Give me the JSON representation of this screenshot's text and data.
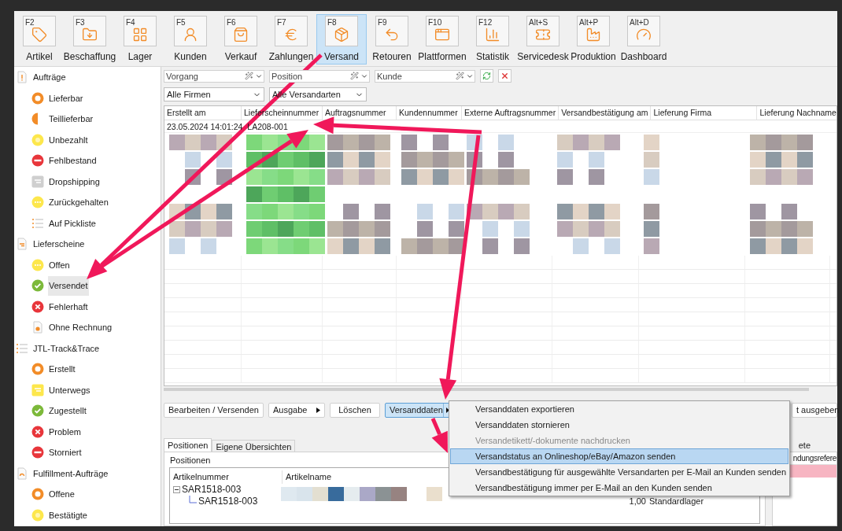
{
  "toolbar": {
    "modules": [
      {
        "key": "F2",
        "label": "Artikel",
        "kind": "tag",
        "selected": false
      },
      {
        "key": "F3",
        "label": "Beschaffung",
        "kind": "folder",
        "selected": false
      },
      {
        "key": "F4",
        "label": "Lager",
        "kind": "grid",
        "selected": false
      },
      {
        "key": "F5",
        "label": "Kunden",
        "kind": "user",
        "selected": false
      },
      {
        "key": "F6",
        "label": "Verkauf",
        "kind": "bag",
        "selected": false
      },
      {
        "key": "F7",
        "label": "Zahlungen",
        "kind": "euro",
        "selected": false
      },
      {
        "key": "F8",
        "label": "Versand",
        "kind": "package",
        "selected": true
      },
      {
        "key": "F9",
        "label": "Retouren",
        "kind": "return",
        "selected": false
      },
      {
        "key": "F10",
        "label": "Plattformen",
        "kind": "window",
        "selected": false
      },
      {
        "key": "F12",
        "label": "Statistik",
        "kind": "chart",
        "selected": false
      },
      {
        "key": "Alt+S",
        "label": "Servicedesk",
        "kind": "ticket",
        "selected": false
      },
      {
        "key": "Alt+P",
        "label": "Produktion",
        "kind": "factory",
        "selected": false
      },
      {
        "key": "Alt+D",
        "label": "Dashboard",
        "kind": "gauge",
        "selected": false
      }
    ]
  },
  "sidebar": {
    "groups": [
      {
        "label": "Aufträge",
        "kind": "order",
        "items": [
          {
            "label": "Lieferbar",
            "kind": "ring-orange",
            "selected": false
          },
          {
            "label": "Teillieferbar",
            "kind": "half",
            "selected": false
          },
          {
            "label": "Unbezahlt",
            "kind": "coin",
            "selected": false
          },
          {
            "label": "Fehlbestand",
            "kind": "minus",
            "selected": false
          },
          {
            "label": "Dropshipping",
            "kind": "note-grey",
            "selected": false
          },
          {
            "label": "Zurückgehalten",
            "kind": "dots",
            "selected": false
          },
          {
            "label": "Auf Pickliste",
            "kind": "list",
            "selected": false
          }
        ]
      },
      {
        "label": "Lieferscheine",
        "kind": "delivery",
        "items": [
          {
            "label": "Offen",
            "kind": "dots",
            "selected": false
          },
          {
            "label": "Versendet",
            "kind": "check",
            "selected": true
          },
          {
            "label": "Fehlerhaft",
            "kind": "cross",
            "selected": false
          },
          {
            "label": "Ohne Rechnung",
            "kind": "doc",
            "selected": false
          }
        ]
      },
      {
        "label": "JTL-Track&Trace",
        "kind": "list",
        "items": [
          {
            "label": "Erstellt",
            "kind": "ring-orange",
            "selected": false
          },
          {
            "label": "Unterwegs",
            "kind": "note-yellow",
            "selected": false
          },
          {
            "label": "Zugestellt",
            "kind": "check",
            "selected": false
          },
          {
            "label": "Problem",
            "kind": "cross",
            "selected": false
          },
          {
            "label": "Storniert",
            "kind": "minus",
            "selected": false
          }
        ]
      },
      {
        "label": "Fulfillment-Aufträge",
        "kind": "fulfillment",
        "items": [
          {
            "label": "Offene",
            "kind": "ring-orange",
            "selected": false
          },
          {
            "label": "Bestätigte",
            "kind": "coin",
            "selected": false
          }
        ]
      }
    ]
  },
  "filters": {
    "fields": [
      {
        "placeholder": "Vorgang"
      },
      {
        "placeholder": "Position"
      },
      {
        "placeholder": "Kunde"
      }
    ],
    "dropdowns": [
      {
        "value": "Alle Firmen"
      },
      {
        "value": "Alle Versandarten"
      }
    ]
  },
  "table": {
    "columns": [
      "Erstellt am",
      "Lieferscheinnummer",
      "Auftragsnummer",
      "Kundennummer",
      "Externe Auftragsnummer",
      "Versandbestätigung am",
      "Lieferung Firma",
      "Lieferung Nachname"
    ],
    "rows": [
      {
        "cells": [
          "23.05.2024 14:01:24",
          "LA208-001"
        ]
      }
    ]
  },
  "buttons": [
    {
      "label": "Bearbeiten / Versenden",
      "kind": "plain"
    },
    {
      "label": "Ausgabe",
      "kind": "submenu"
    },
    {
      "label": "Löschen",
      "kind": "plain"
    },
    {
      "label": "Versanddaten",
      "kind": "split",
      "selected": true
    },
    {
      "label": "t ausgeben",
      "kind": "plain"
    }
  ],
  "menu": {
    "items": [
      {
        "label": "Versanddaten exportieren",
        "disabled": false,
        "selected": false
      },
      {
        "label": "Versanddaten stornieren",
        "disabled": false,
        "selected": false
      },
      {
        "label": "Versandetikett/-dokumente nachdrucken",
        "disabled": true,
        "selected": false
      },
      {
        "label": "Versandstatus an Onlineshop/eBay/Amazon senden",
        "disabled": false,
        "selected": true
      },
      {
        "label": "Versandbestätigung für ausgewählte Versandarten per E-Mail an Kunden senden",
        "disabled": false,
        "selected": false
      },
      {
        "label": "Versandbestätigung immer per E-Mail an den Kunden senden",
        "disabled": false,
        "selected": false
      }
    ]
  },
  "detail_tabs": [
    {
      "label": "Positionen",
      "selected": true
    },
    {
      "label": "Eigene Übersichten",
      "selected": false
    }
  ],
  "positions": {
    "title": "Positionen",
    "columns": [
      "Artikelnummer",
      "Artikelname"
    ],
    "rows": [
      {
        "article_number": "SAR1518-003",
        "expanded": true,
        "children": [
          {
            "article_number": "SAR1518-003",
            "column_3": "1,00",
            "column_4": "Standardlager"
          }
        ]
      }
    ]
  },
  "right_panel": {
    "tab": "ete",
    "column": "ndungsrefere"
  }
}
